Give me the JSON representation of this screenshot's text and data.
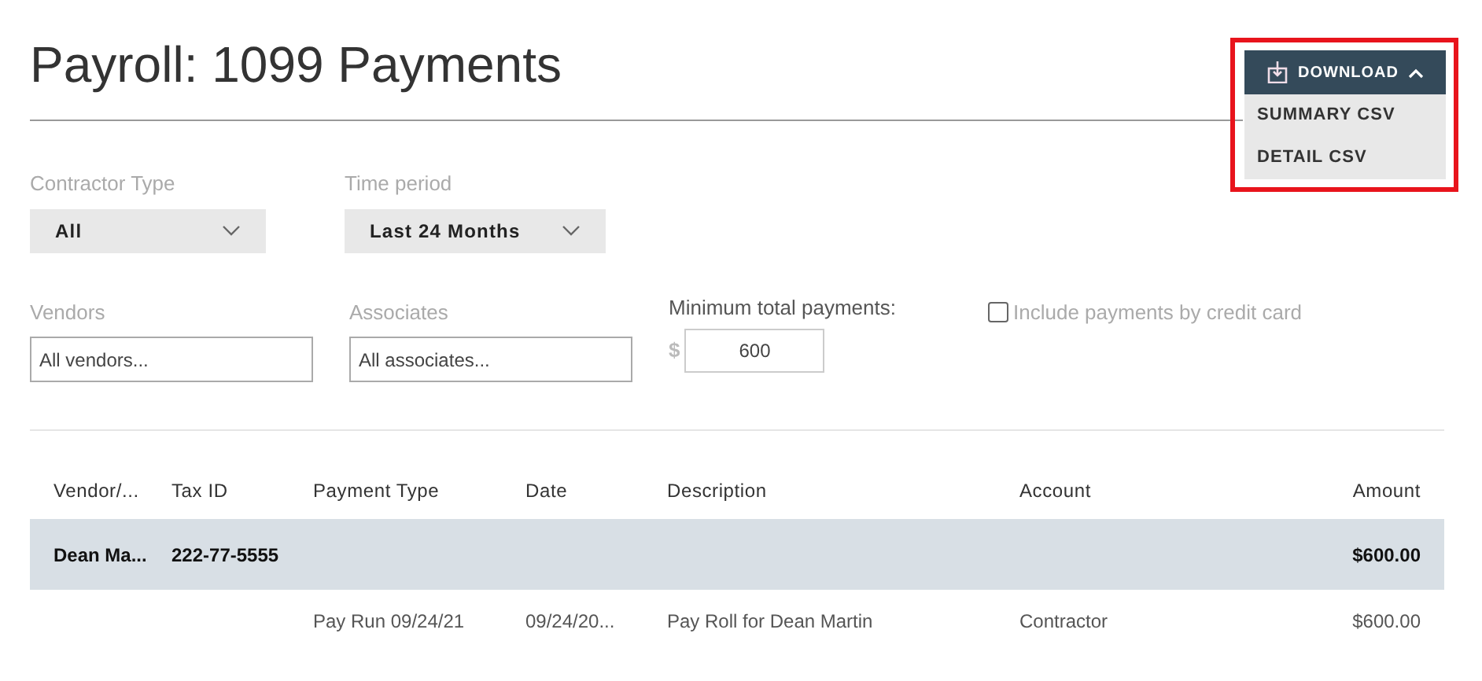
{
  "title": "Payroll: 1099 Payments",
  "download": {
    "label": "DOWNLOAD",
    "expanded": true,
    "items": [
      "SUMMARY CSV",
      "DETAIL CSV"
    ],
    "highlighted": true
  },
  "filters": {
    "contractor_type": {
      "label": "Contractor Type",
      "value": "All"
    },
    "time_period": {
      "label": "Time period",
      "value": "Last 24 Months"
    },
    "vendors": {
      "label": "Vendors",
      "placeholder": "All vendors..."
    },
    "associates": {
      "label": "Associates",
      "placeholder": "All associates..."
    },
    "minimum_total": {
      "label": "Minimum total payments:",
      "currency": "$",
      "value": "600"
    },
    "credit_card": {
      "label": "Include payments by credit card",
      "checked": false
    }
  },
  "table": {
    "columns": [
      "Vendor/...",
      "Tax ID",
      "Payment Type",
      "Date",
      "Description",
      "Account",
      "Amount"
    ],
    "rows": [
      {
        "kind": "group",
        "cells": [
          "Dean Ma...",
          "222-77-5555",
          "",
          "",
          "",
          "",
          "$600.00"
        ]
      },
      {
        "kind": "detail",
        "cells": [
          "",
          "",
          "Pay Run 09/24/21",
          "09/24/20...",
          "Pay Roll for Dean Martin",
          "Contractor",
          "$600.00"
        ]
      }
    ]
  }
}
